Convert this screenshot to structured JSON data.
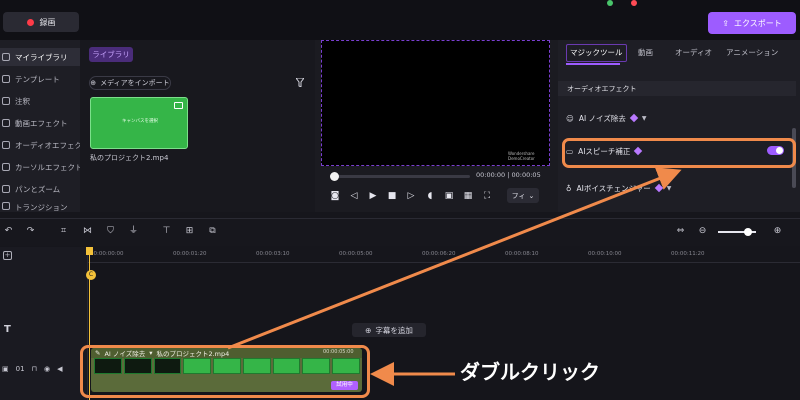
{
  "topbar": {
    "record_label": "録画",
    "export_label": "エクスポート"
  },
  "sidebar": {
    "items": [
      {
        "label": "マイライブラリ",
        "active": true
      },
      {
        "label": "テンプレート"
      },
      {
        "label": "注釈"
      },
      {
        "label": "動画エフェクト"
      },
      {
        "label": "オーディオエフェクト"
      },
      {
        "label": "カーソルエフェクト"
      },
      {
        "label": "パンとズーム"
      },
      {
        "label": "トランジション"
      }
    ]
  },
  "library": {
    "tab": "ライブラリ",
    "import_label": "メディアをインポート",
    "media": [
      {
        "name": "私のプロジェクト2.mp4",
        "thumb_text": "キャンバスを選択"
      }
    ]
  },
  "player": {
    "watermark": "Wondershare DemoCreator",
    "timecode": "00:00:00 | 00:00:05",
    "fit_label": "フィ",
    "progress": 0.0
  },
  "right_panel": {
    "tabs": [
      "マジックツール",
      "動画",
      "オーディオ",
      "アニメーション"
    ],
    "active_tab": "マジックツール",
    "section": "オーディオエフェクト",
    "features": [
      {
        "label": "AI ノイズ除去"
      },
      {
        "label": "AIスピーチ補正",
        "enabled": true
      },
      {
        "label": "AIボイスチェンジャー"
      }
    ]
  },
  "timeline": {
    "ticks": [
      "00:00:00:00",
      "00:00:01:20",
      "00:00:03:10",
      "00:00:05:00",
      "00:00:06:20",
      "00:00:08:10",
      "00:00:10:00",
      "00:00:11:20"
    ],
    "add_subtitle": "字幕を追加",
    "track_number": "01",
    "playhead_label": "C",
    "clip": {
      "effect": "AI ノイズ除去",
      "name": "私のプロジェクト2.mp4",
      "timecode": "00:00:05:00",
      "badge": "試用中"
    }
  },
  "annotation": {
    "text": "ダブルクリック",
    "color": "#f08a4b"
  },
  "colors": {
    "accent": "#9d5cff",
    "annotation": "#f08a4b",
    "clip_green": "#35b548"
  }
}
